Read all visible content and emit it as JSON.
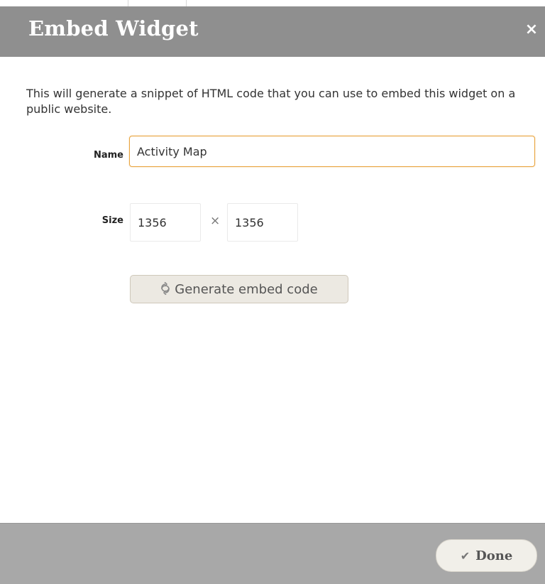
{
  "dialog": {
    "title": "Embed Widget",
    "close_label": "×",
    "description": "This will generate a snippet of HTML code that you can use to embed this widget on a public website."
  },
  "form": {
    "name": {
      "label": "Name",
      "value": "Activity Map"
    },
    "size": {
      "label": "Size",
      "width": "1356",
      "separator": "×",
      "height": "1356"
    },
    "generate_button": {
      "icon": "refresh-icon",
      "label": "Generate embed code"
    }
  },
  "footer": {
    "done_button": {
      "icon": "check-icon",
      "label": "Done"
    }
  },
  "colors": {
    "header_bg": "#8f8f8f",
    "footer_bg": "#a8a8a8",
    "focus_border": "#e8a33c",
    "button_bg": "#ece9e2"
  }
}
